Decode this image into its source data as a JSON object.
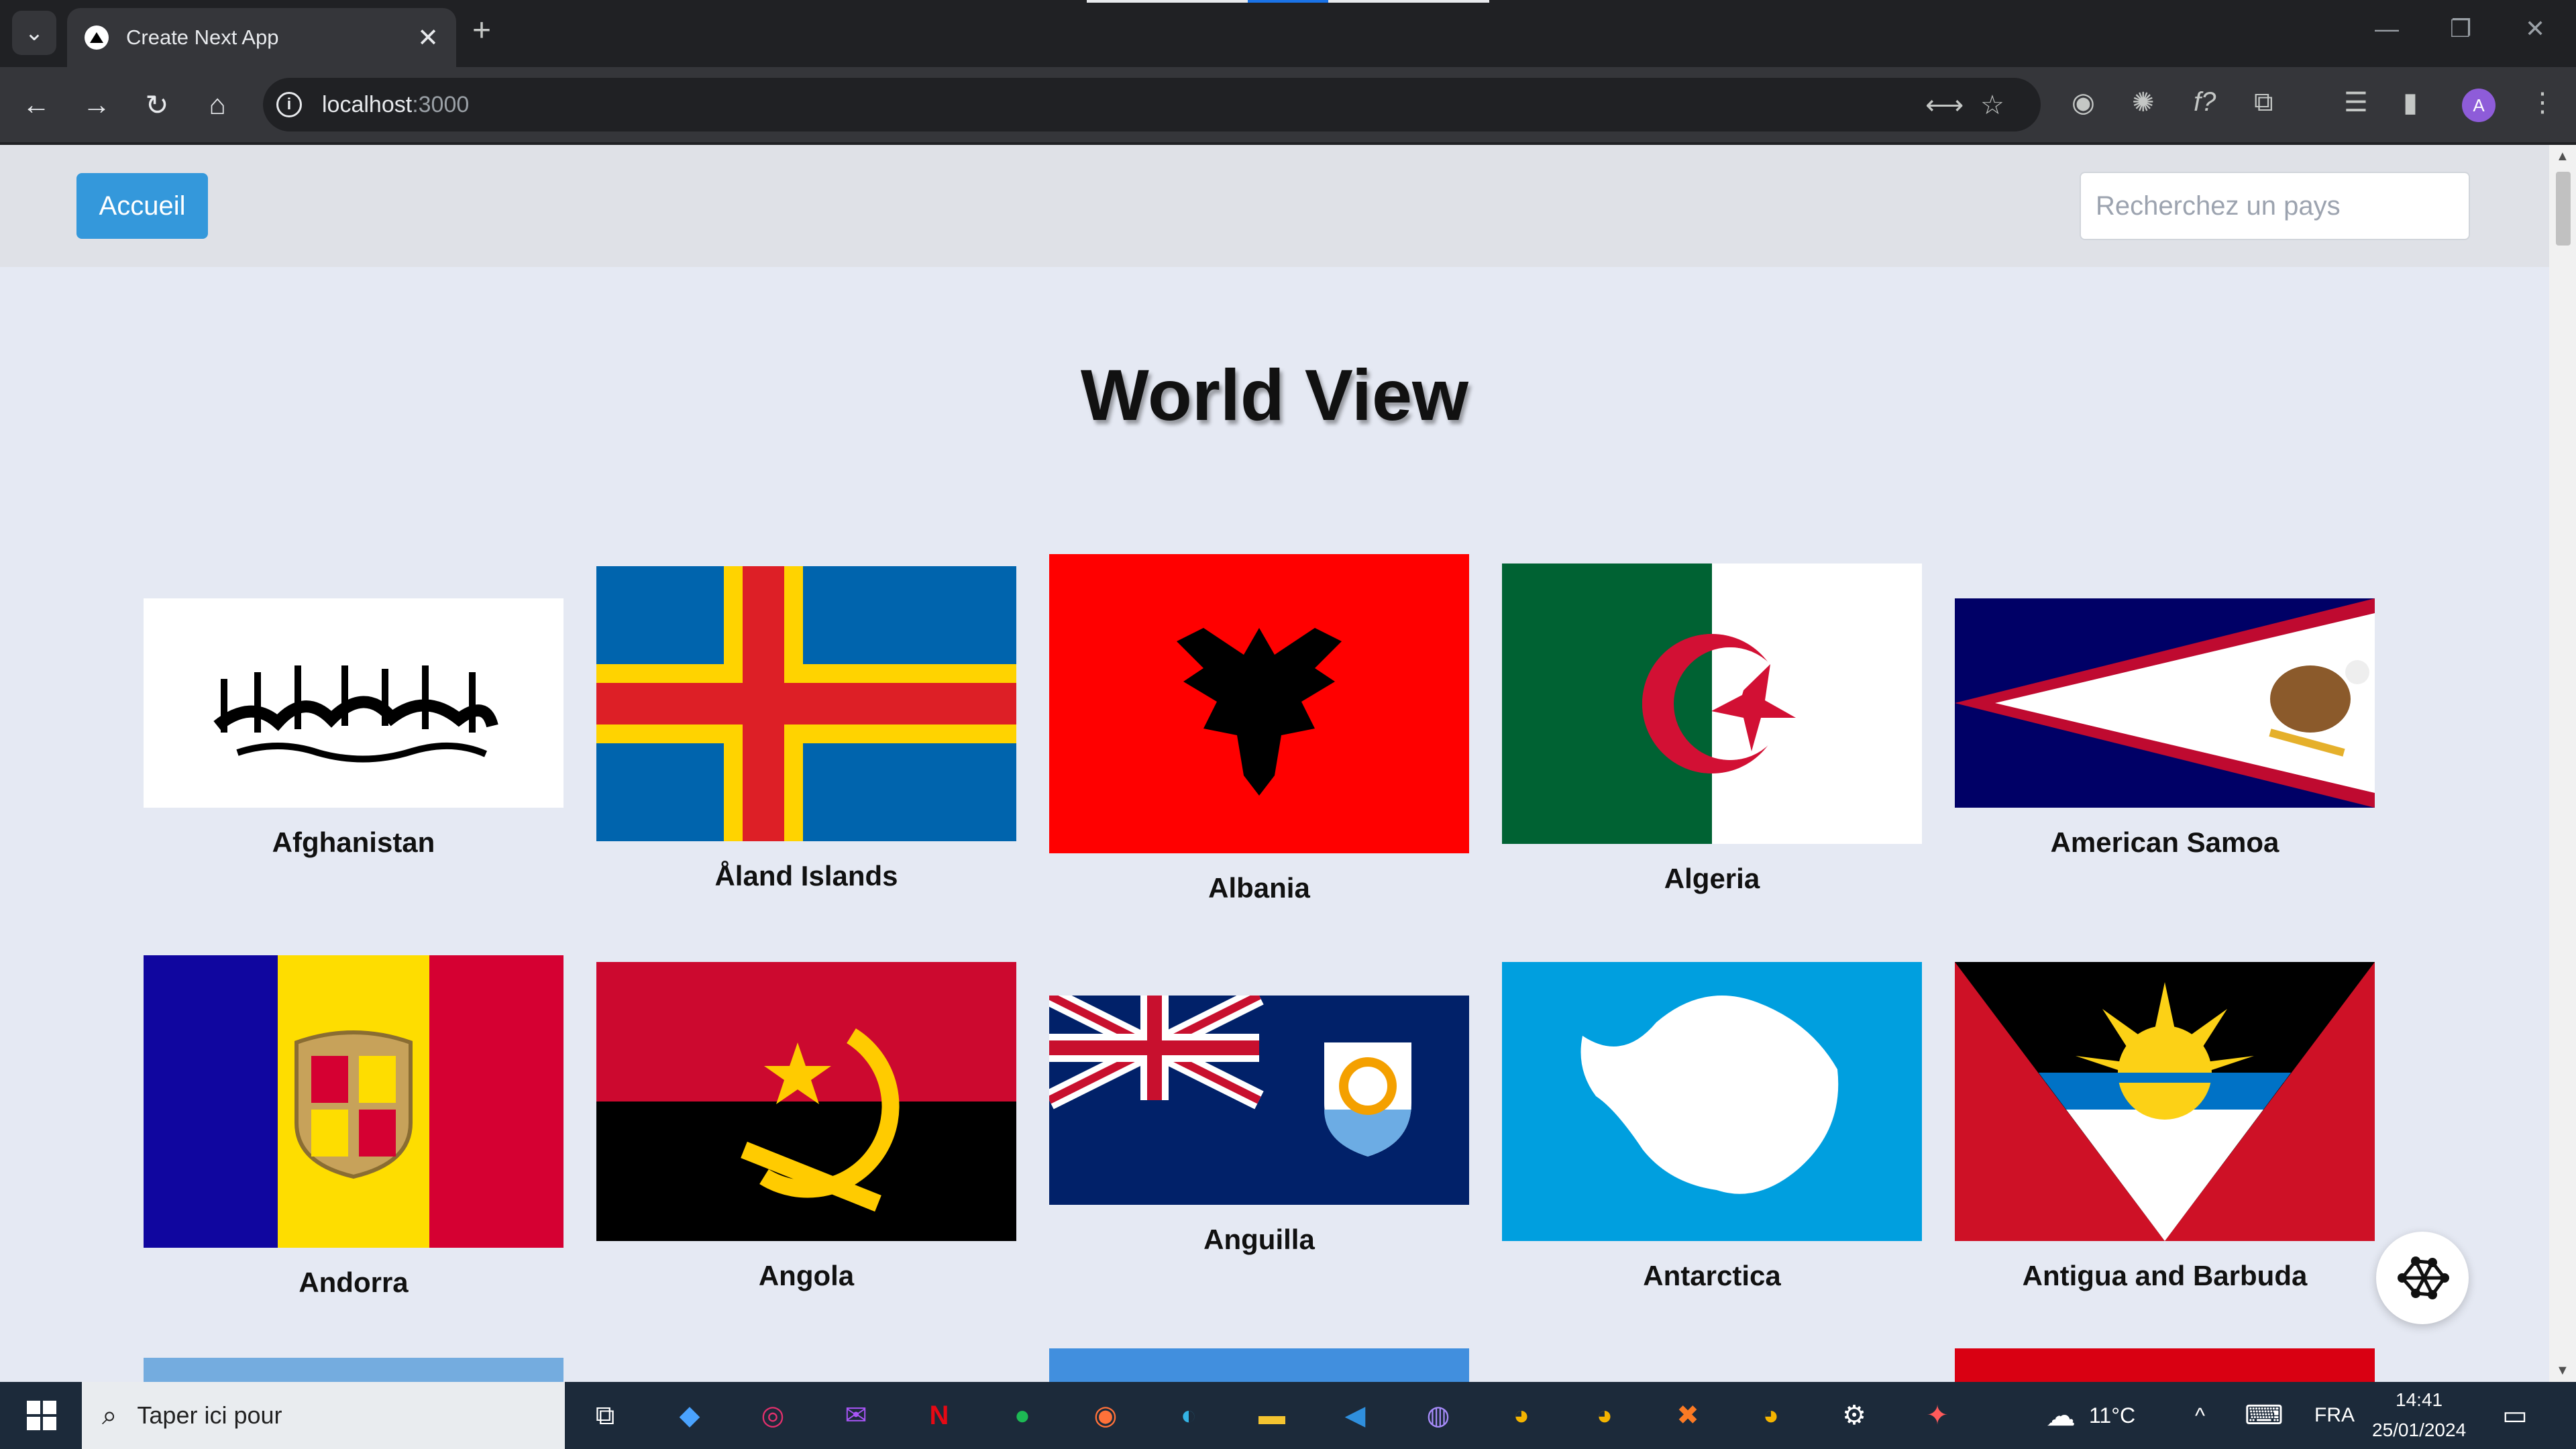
{
  "browser": {
    "tab_title": "Create Next App",
    "tab_close": "✕",
    "new_tab": "+",
    "url_host": "localhost",
    "url_port": ":3000",
    "profile_initial": "A"
  },
  "navbar": {
    "home_label": "Accueil",
    "search_placeholder": "Recherchez un pays"
  },
  "page": {
    "title": "World View"
  },
  "countries": [
    {
      "name": "Afghanistan"
    },
    {
      "name": "Åland Islands"
    },
    {
      "name": "Albania"
    },
    {
      "name": "Algeria"
    },
    {
      "name": "American Samoa"
    },
    {
      "name": "Andorra"
    },
    {
      "name": "Angola"
    },
    {
      "name": "Anguilla"
    },
    {
      "name": "Antarctica"
    },
    {
      "name": "Antigua and Barbuda"
    }
  ],
  "taskbar": {
    "search_text": "Taper ici pour",
    "weather": "11°C",
    "language": "FRA",
    "time": "14:41",
    "date": "25/01/2024"
  },
  "colors": {
    "accent": "#3498db",
    "page_bg": "#e5e9f3",
    "navbar_bg": "#dfe1e7"
  }
}
